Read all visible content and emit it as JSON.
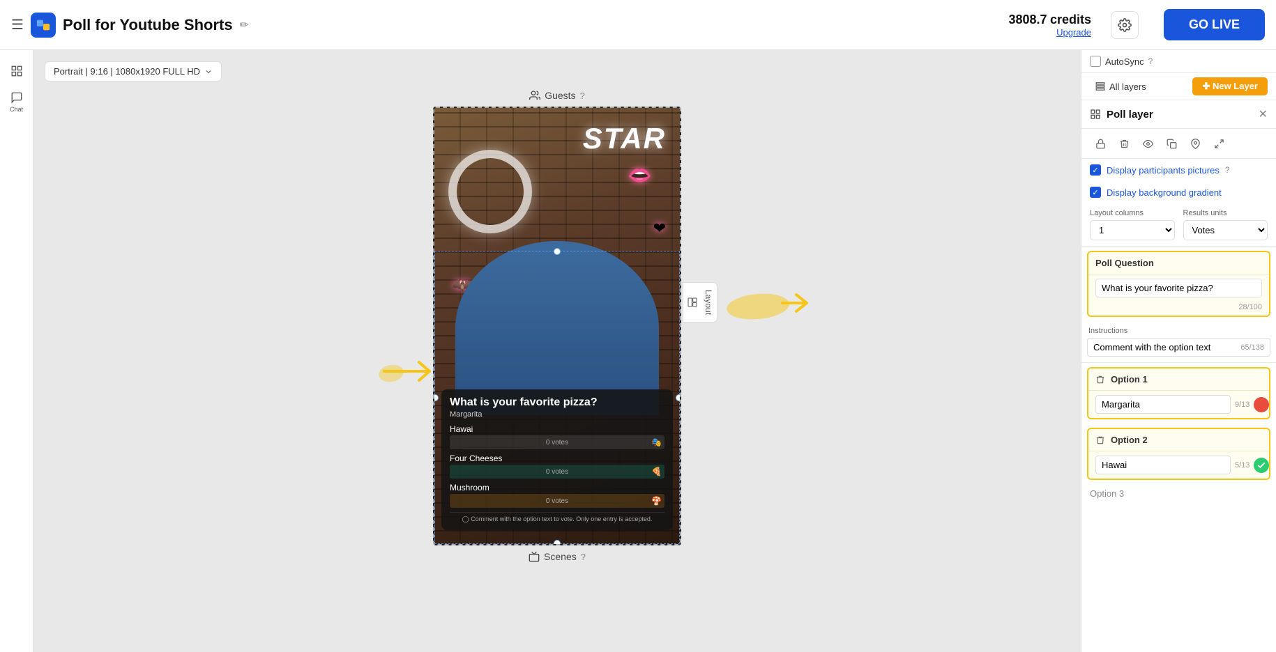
{
  "header": {
    "title": "Poll for Youtube Shorts",
    "credits": "3808.7",
    "credits_label": "credits",
    "upgrade_label": "Upgrade",
    "go_live_label": "GO LIVE"
  },
  "toolbar": {
    "resolution": "Portrait | 9:16 | 1080x1920 FULL HD"
  },
  "canvas": {
    "guests_label": "Guests",
    "scenes_label": "Scenes"
  },
  "right_panel": {
    "autosync_label": "AutoSync",
    "all_layers_label": "All layers",
    "new_layer_label": "✚ New Layer",
    "poll_layer_title": "Poll layer",
    "display_participants": "Display participants pictures",
    "display_background": "Display background gradient",
    "layout_columns_label": "Layout columns",
    "results_units_label": "Results units",
    "layout_columns_value": "1",
    "results_units_value": "Votes",
    "poll_question_label": "Poll Question",
    "poll_question_value": "What is your favorite pizza?",
    "poll_question_chars": "28/100",
    "instructions_label": "Instructions",
    "instructions_value": "Comment with the option text",
    "instructions_chars": "65/138",
    "option1_label": "Option 1",
    "option1_value": "Margarita",
    "option1_chars": "9/13",
    "option2_label": "Option 2",
    "option2_value": "Hawai",
    "option2_chars": "5/13",
    "option3_label": "Option 3"
  },
  "poll_preview": {
    "question": "What is your favorite pizza?",
    "subtitle": "Margarita",
    "options": [
      {
        "name": "Hawai",
        "votes": "0 votes",
        "emoji": "🎭🗡"
      },
      {
        "name": "Four Cheeses",
        "votes": "0 votes",
        "emoji": "🍕🎭"
      },
      {
        "name": "Mushroom",
        "votes": "0 votes",
        "emoji": "🍄🎭"
      }
    ],
    "instruction": "◯ Comment with the option text to vote. Only one entry is accepted."
  },
  "icons": {
    "layers": "⊞",
    "trash": "🗑",
    "eye": "👁",
    "copy": "⧉",
    "pin": "📌",
    "lock": "🔒",
    "chat": "Chat",
    "scenes_icon": "⊞",
    "guests_icon": "👥"
  }
}
